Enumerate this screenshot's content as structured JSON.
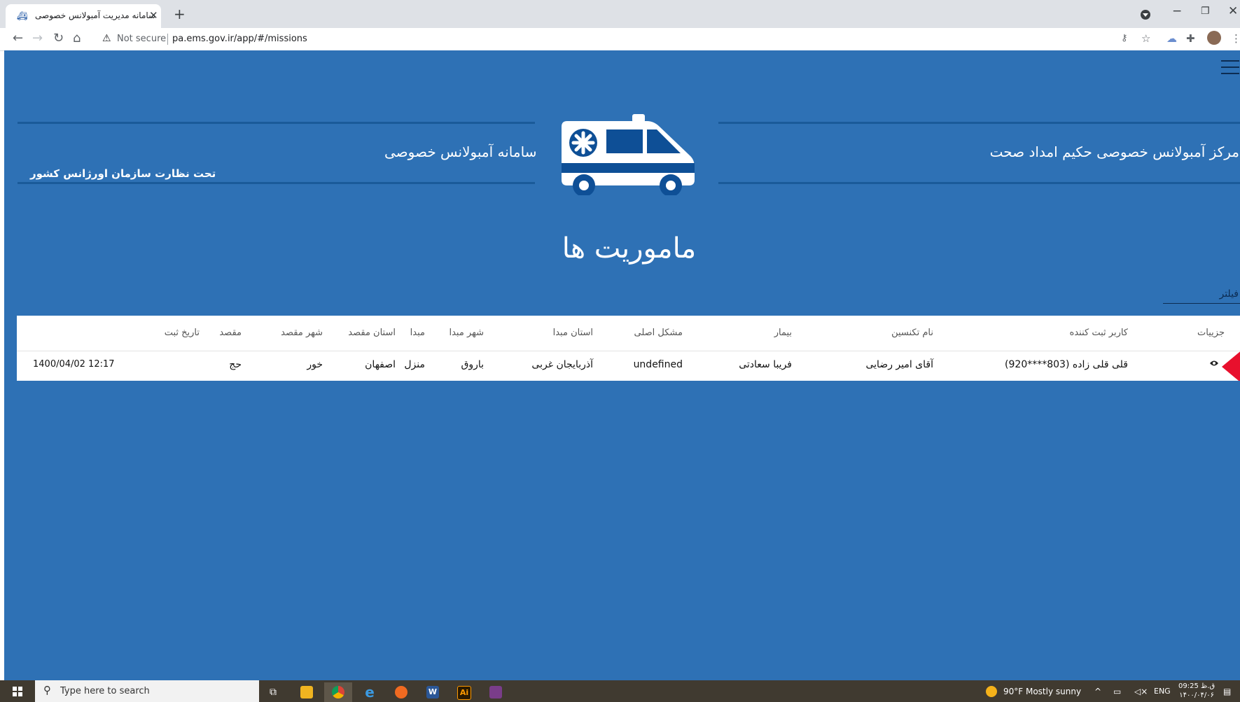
{
  "browser": {
    "tab_title": "سامانه مدیریت آمبولانس خصوصی",
    "tab_favicon": "ambulance-icon",
    "not_secure": "Not secure",
    "url": "pa.ems.gov.ir/app/#/missions"
  },
  "header": {
    "center_name": "مرکز آمبولانس خصوصی حکیم امداد صحت",
    "system_name": "سامانه آمبولانس خصوصی",
    "supervision": "تحت نظارت سازمان اورژانس کشور"
  },
  "page": {
    "title": "ماموریت ها",
    "filter_label": "فیلتر"
  },
  "table": {
    "headers": {
      "details": "جزییات",
      "registrar": "کاربر ثبت کننده",
      "technician": "نام تکنسین",
      "patient": "بیمار",
      "main_problem": "مشکل اصلی",
      "origin_province": "استان مبدا",
      "origin_city": "شهر مبدا",
      "origin": "مبدا",
      "dest_province": "استان مقصد",
      "dest_city": "شهر مقصد",
      "destination": "مقصد",
      "reg_date": "تاریخ ثبت"
    },
    "rows": [
      {
        "registrar": "قلی قلی زاده (803****920)",
        "technician": "آقای امیر رضایی",
        "patient": "فریبا سعادتی",
        "main_problem": "undefined",
        "origin_province": "آذربایجان غربی",
        "origin_city": "باروق",
        "origin": "منزل",
        "dest_province": "اصفهان",
        "dest_city": "خور",
        "destination": "حج",
        "reg_date": "1400/04/02 12:17"
      }
    ]
  },
  "taskbar": {
    "search_placeholder": "Type here to search",
    "weather": "90°F  Mostly sunny",
    "language": "ENG",
    "time": "09:25 ق.ظ",
    "date": "۱۴۰۰/۰۴/۰۶"
  },
  "colors": {
    "page_bg": "#2e71b5",
    "line": "#1a5a99",
    "ambulance": "#0e4f96",
    "accent_red": "#e8102d"
  }
}
